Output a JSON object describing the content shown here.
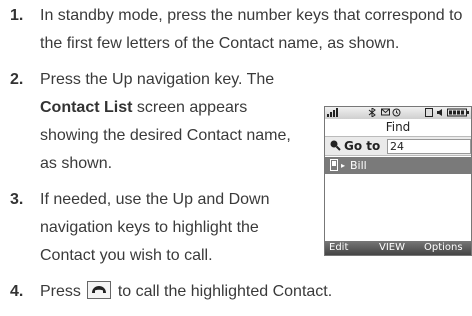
{
  "steps": [
    {
      "num": "1.",
      "lines": [
        "In standby mode, press the number keys that correspond to",
        "the first few letters of the Contact name, as shown."
      ]
    },
    {
      "num": "2.",
      "line1": "Press the Up navigation key. The",
      "bold": "Contact List",
      "line2_after": " screen appears",
      "line3": "showing the desired Contact name,",
      "line4": "as shown."
    },
    {
      "num": "3.",
      "lines": [
        "If needed, use the Up and Down",
        "navigation keys to highlight the",
        "Contact you wish to call."
      ]
    },
    {
      "num": "4.",
      "before": "Press",
      "after": "to call the highlighted Contact.",
      "icon": "send-key-icon"
    }
  ],
  "phone": {
    "title": "Find",
    "search_label": "Go to",
    "search_value": "24",
    "contact": "Bill",
    "softkeys": [
      "Edit",
      "VIEW",
      "Options"
    ]
  }
}
